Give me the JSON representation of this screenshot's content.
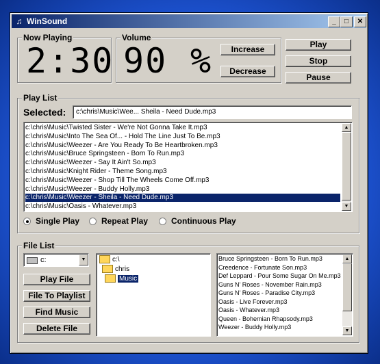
{
  "window": {
    "title": "WinSound"
  },
  "now_playing": {
    "label": "Now Playing",
    "time": "2:30"
  },
  "volume": {
    "label": "Volume",
    "value": "90",
    "unit": "%",
    "increase": "Increase",
    "decrease": "Decrease"
  },
  "controls": {
    "play": "Play",
    "stop": "Stop",
    "pause": "Pause"
  },
  "playlist": {
    "label": "Play List",
    "selected_label": "Selected:",
    "selected_value": "c:\\chris\\Music\\Wee... Sheila - Need Dude.mp3",
    "items": [
      "c:\\chris\\Music\\Twisted Sister - We're Not Gonna Take It.mp3",
      "c:\\chris\\Music\\Into The Sea Of... - Hold The Line Just To Be.mp3",
      "c:\\chris\\Music\\Weezer - Are You Ready To Be Heartbroken.mp3",
      "c:\\chris\\Music\\Bruce Springsteen - Born To Run.mp3",
      "c:\\chris\\Music\\Weezer - Say It Ain't So.mp3",
      "c:\\chris\\Music\\Knight Rider - Theme Song.mp3",
      "c:\\chris\\Music\\Weezer - Shop Till The Wheels Come Off.mp3",
      "c:\\chris\\Music\\Weezer - Buddy Holly.mp3",
      "c:\\chris\\Music\\Weezer - Sheila - Need Dude.mp3",
      "c:\\chris\\Music\\Oasis - Whatever.mp3"
    ],
    "selected_index": 8,
    "modes": [
      "Single Play",
      "Repeat Play",
      "Continuous Play"
    ],
    "mode_selected": 0
  },
  "filelist": {
    "label": "File List",
    "drive": "c:",
    "buttons": [
      "Play File",
      "File To Playlist",
      "Find Music",
      "Delete File"
    ],
    "tree": [
      "c:\\",
      "chris",
      "Music"
    ],
    "tree_selected": 2,
    "files": [
      "Bruce Springsteen - Born To Run.mp3",
      "Creedence - Fortunate Son.mp3",
      "Def Leppard - Pour Some Sugar On Me.mp3",
      "Guns N' Roses - November Rain.mp3",
      "Guns N' Roses - Paradise City.mp3",
      "Oasis - Live Forever.mp3",
      "Oasis - Whatever.mp3",
      "Queen - Bohemian Rhapsody.mp3",
      "Weezer - Buddy Holly.mp3"
    ]
  }
}
